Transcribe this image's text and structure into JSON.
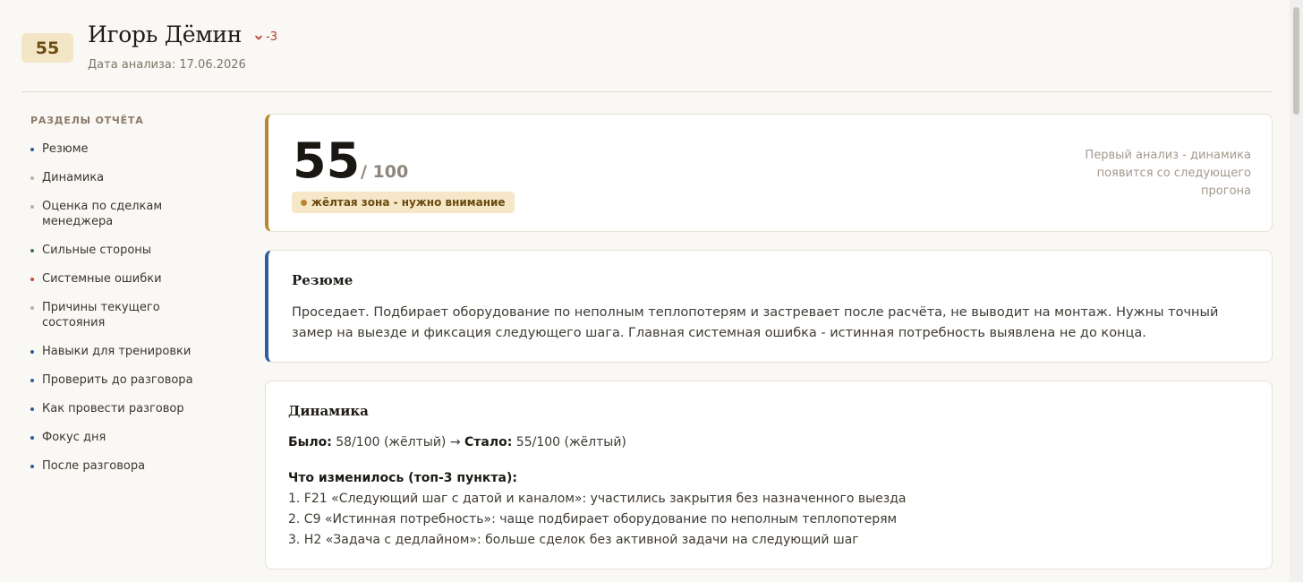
{
  "header": {
    "score": "55",
    "name": "Игорь Дёмин",
    "delta": "-3",
    "date": "Дата анализа: 17.06.2026"
  },
  "sidebar": {
    "title": "РАЗДЕЛЫ ОТЧЁТА",
    "items": [
      {
        "label": "Резюме",
        "dot_color": "#2d5d9c"
      },
      {
        "label": "Динамика",
        "dot_color": "#b9b1a3"
      },
      {
        "label": "Оценка по сделкам менеджера",
        "dot_color": "#b9b1a3"
      },
      {
        "label": "Сильные стороны",
        "dot_color": "#3f7a4e"
      },
      {
        "label": "Системные ошибки",
        "dot_color": "#c0503e"
      },
      {
        "label": "Причины текущего состояния",
        "dot_color": "#b9b1a3"
      },
      {
        "label": "Навыки для тренировки",
        "dot_color": "#2d5d9c"
      },
      {
        "label": "Проверить до разговора",
        "dot_color": "#2d5d9c"
      },
      {
        "label": "Как провести разговор",
        "dot_color": "#2d5d9c"
      },
      {
        "label": "Фокус дня",
        "dot_color": "#2d5d9c"
      },
      {
        "label": "После разговора",
        "dot_color": "#2d5d9c"
      }
    ]
  },
  "score_card": {
    "score": "55",
    "out_of": "/ 100",
    "zone": "жёлтая зона - нужно внимание",
    "zone_color": "#b8872f",
    "note": "Первый анализ - динамика появится со следующего прогона"
  },
  "resume": {
    "title": "Резюме",
    "body": "Проседает. Подбирает оборудование по неполным теплопотерям и застревает после расчёта, не выводит на монтаж. Нужны точный замер на выезде и фиксация следующего шага. Главная системная ошибка - истинная потребность выявлена не до конца."
  },
  "dynamics": {
    "title": "Динамика",
    "was_label": "Было:",
    "was_value": "58/100 (жёлтый)",
    "arrow": "→",
    "now_label": "Стало:",
    "now_value": "55/100 (жёлтый)",
    "changes_title": "Что изменилось (топ-3 пункта):",
    "changes": [
      "1. F21 «Следующий шаг с датой и каналом»: участились закрытия без назначенного выезда",
      "2. C9 «Истинная потребность»: чаще подбирает оборудование по неполным теплопотерям",
      "3. H2 «Задача с дедлайном»: больше сделок без активной задачи на следующий шаг"
    ]
  }
}
